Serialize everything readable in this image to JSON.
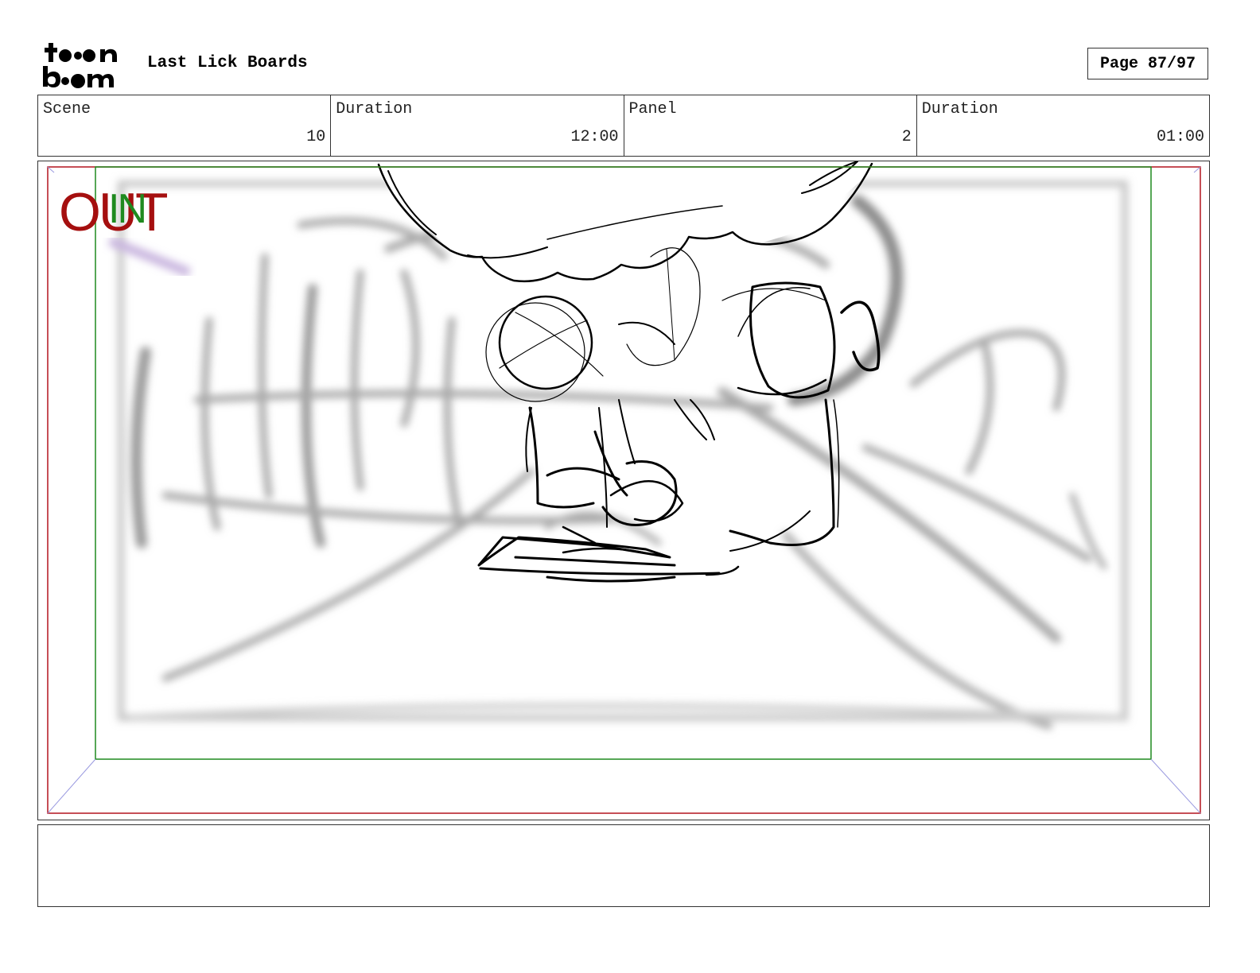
{
  "header": {
    "logo_text": "toon boom",
    "project_title": "Last Lick Boards",
    "page_label": "Page 87/97"
  },
  "info_bar": {
    "scene_label": "Scene",
    "scene_value": "10",
    "scene_duration_label": "Duration",
    "scene_duration_value": "12:00",
    "panel_label": "Panel",
    "panel_value": "2",
    "panel_duration_label": "Duration",
    "panel_duration_value": "01:00"
  },
  "frame_guides": {
    "out_label": "OUT",
    "in_label": "IN",
    "out_color": "#a50f0f",
    "in_color": "#1f8a1f"
  },
  "notes": {
    "text": ""
  }
}
